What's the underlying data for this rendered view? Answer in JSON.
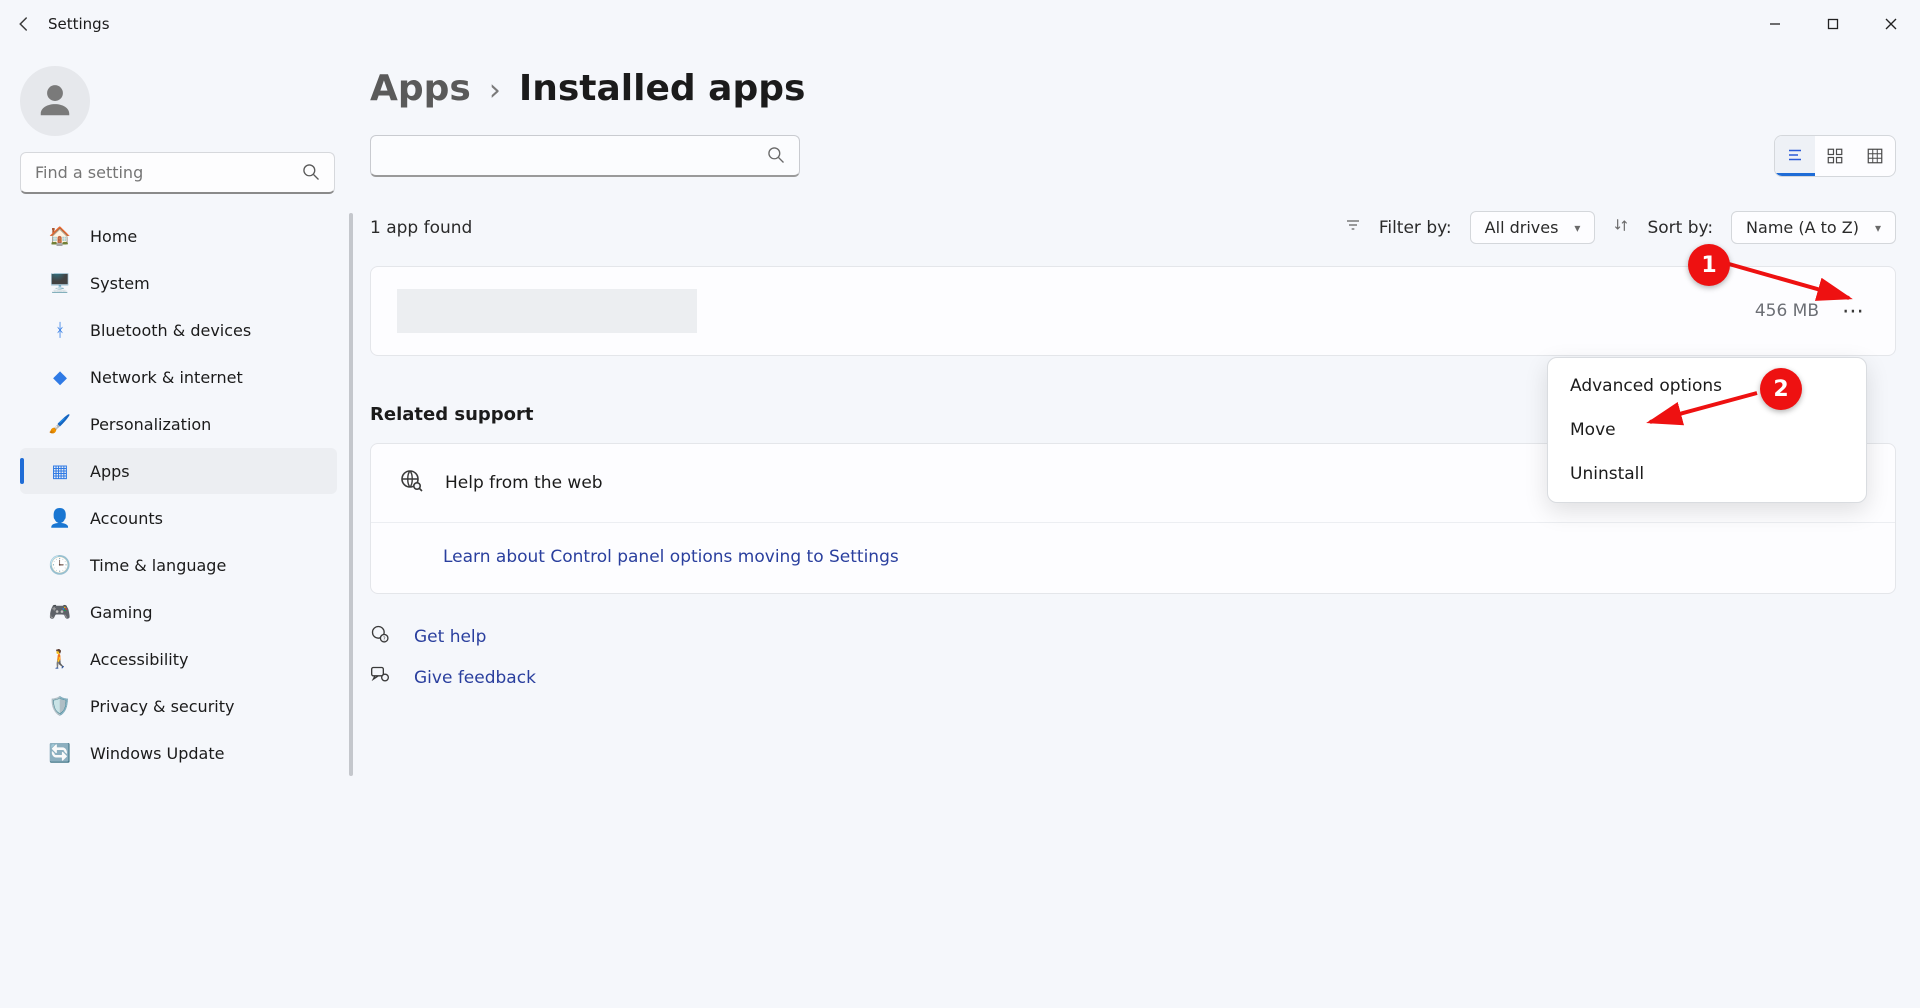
{
  "window": {
    "title": "Settings"
  },
  "search_sidebar": {
    "placeholder": "Find a setting"
  },
  "sidebar": {
    "items": [
      {
        "label": "Home",
        "icon": "🏠",
        "color": "#e4833a"
      },
      {
        "label": "System",
        "icon": "🖥️",
        "color": "#2f7ae5"
      },
      {
        "label": "Bluetooth & devices",
        "icon": "ᚼ",
        "color": "#2f7ae5"
      },
      {
        "label": "Network & internet",
        "icon": "◆",
        "color": "#2f7ae5"
      },
      {
        "label": "Personalization",
        "icon": "🖌️",
        "color": "#7a4a2a"
      },
      {
        "label": "Apps",
        "icon": "▦",
        "color": "#2f7ae5"
      },
      {
        "label": "Accounts",
        "icon": "👤",
        "color": "#2fae5a"
      },
      {
        "label": "Time & language",
        "icon": "🕒",
        "color": "#4a7ab5"
      },
      {
        "label": "Gaming",
        "icon": "🎮",
        "color": "#8a8a8a"
      },
      {
        "label": "Accessibility",
        "icon": "🚶",
        "color": "#1f6cd6"
      },
      {
        "label": "Privacy & security",
        "icon": "🛡️",
        "color": "#9aa0a6"
      },
      {
        "label": "Windows Update",
        "icon": "🔄",
        "color": "#1f6cd6"
      }
    ],
    "activeIndex": 5
  },
  "breadcrumb": {
    "parent": "Apps",
    "current": "Installed apps"
  },
  "app_search": {
    "placeholder": ""
  },
  "view": {
    "options": [
      "list",
      "tiles",
      "grid"
    ],
    "active": 0
  },
  "meta": {
    "found_text": "1 app found",
    "filter_label": "Filter by:",
    "filter_value": "All drives",
    "sort_label": "Sort by:",
    "sort_value": "Name (A to Z)"
  },
  "app_row": {
    "size": "456 MB"
  },
  "context_menu": {
    "items": [
      "Advanced options",
      "Move",
      "Uninstall"
    ]
  },
  "related": {
    "heading": "Related support",
    "help_title": "Help from the web",
    "link1": "Learn about Control panel options moving to Settings"
  },
  "footer": {
    "get_help": "Get help",
    "give_feedback": "Give feedback"
  },
  "annotations": {
    "n1": "1",
    "n2": "2"
  }
}
